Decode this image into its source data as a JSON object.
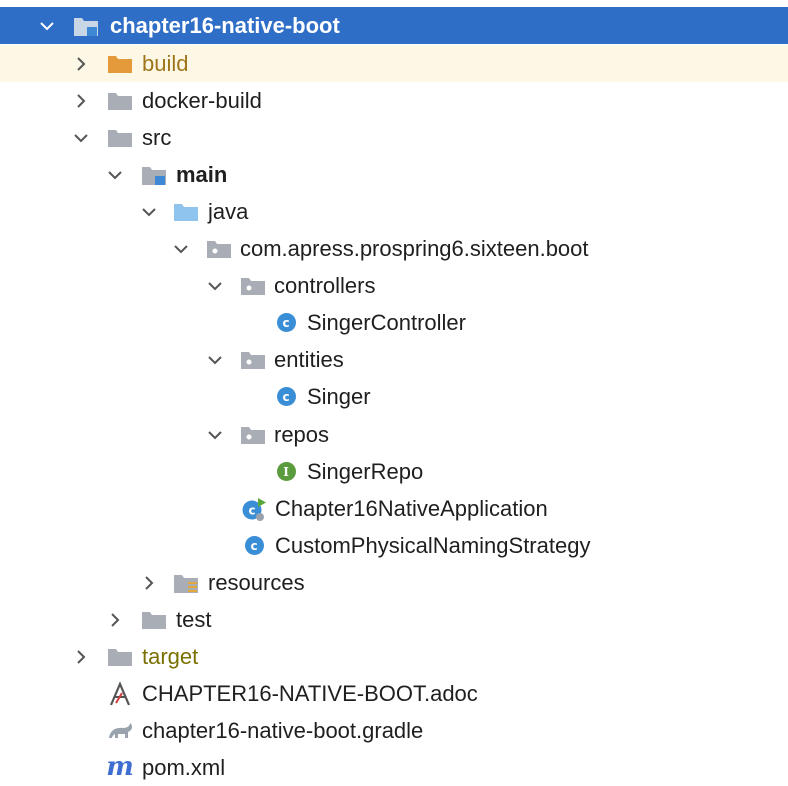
{
  "colors": {
    "selection": "#2f6ec7",
    "highlight_row": "#fdf8e6",
    "folder_gray": "#a9aeb6",
    "folder_orange": "#e49a3a",
    "folder_blue": "#8fc4ef",
    "module_blue": "#3d89d6",
    "class_badge": "#3a8ed6",
    "interface_badge": "#5a9c3d"
  },
  "tree": {
    "root": {
      "label": "chapter16-native-boot",
      "icon": "module-folder-icon",
      "expanded": true,
      "selected": true
    },
    "build": {
      "label": "build",
      "icon": "folder-orange-icon",
      "expanded": false
    },
    "docker_build": {
      "label": "docker-build",
      "icon": "folder-icon",
      "expanded": false
    },
    "src": {
      "label": "src",
      "icon": "folder-icon",
      "expanded": true
    },
    "main": {
      "label": "main",
      "icon": "source-root-folder-icon",
      "expanded": true
    },
    "java": {
      "label": "java",
      "icon": "java-folder-icon",
      "expanded": true
    },
    "package": {
      "label": "com.apress.prospring6.sixteen.boot",
      "icon": "package-icon",
      "expanded": true
    },
    "controllers": {
      "label": "controllers",
      "icon": "package-icon",
      "expanded": true
    },
    "singer_controller": {
      "label": "SingerController",
      "icon": "class-icon",
      "badge": "c"
    },
    "entities": {
      "label": "entities",
      "icon": "package-icon",
      "expanded": true
    },
    "singer": {
      "label": "Singer",
      "icon": "class-icon",
      "badge": "c"
    },
    "repos": {
      "label": "repos",
      "icon": "package-icon",
      "expanded": true
    },
    "singer_repo": {
      "label": "SingerRepo",
      "icon": "interface-icon",
      "badge": "I"
    },
    "application": {
      "label": "Chapter16NativeApplication",
      "icon": "spring-boot-class-icon",
      "badge": "c"
    },
    "naming_strategy": {
      "label": "CustomPhysicalNamingStrategy",
      "icon": "class-icon",
      "badge": "c"
    },
    "resources": {
      "label": "resources",
      "icon": "resources-folder-icon",
      "expanded": false
    },
    "test": {
      "label": "test",
      "icon": "folder-icon",
      "expanded": false
    },
    "target": {
      "label": "target",
      "icon": "folder-icon",
      "expanded": false
    },
    "adoc": {
      "label": "CHAPTER16-NATIVE-BOOT.adoc",
      "icon": "asciidoc-file-icon"
    },
    "gradle": {
      "label": "chapter16-native-boot.gradle",
      "icon": "gradle-file-icon"
    },
    "pom": {
      "label": "pom.xml",
      "icon": "maven-file-icon",
      "badge": "m"
    }
  }
}
